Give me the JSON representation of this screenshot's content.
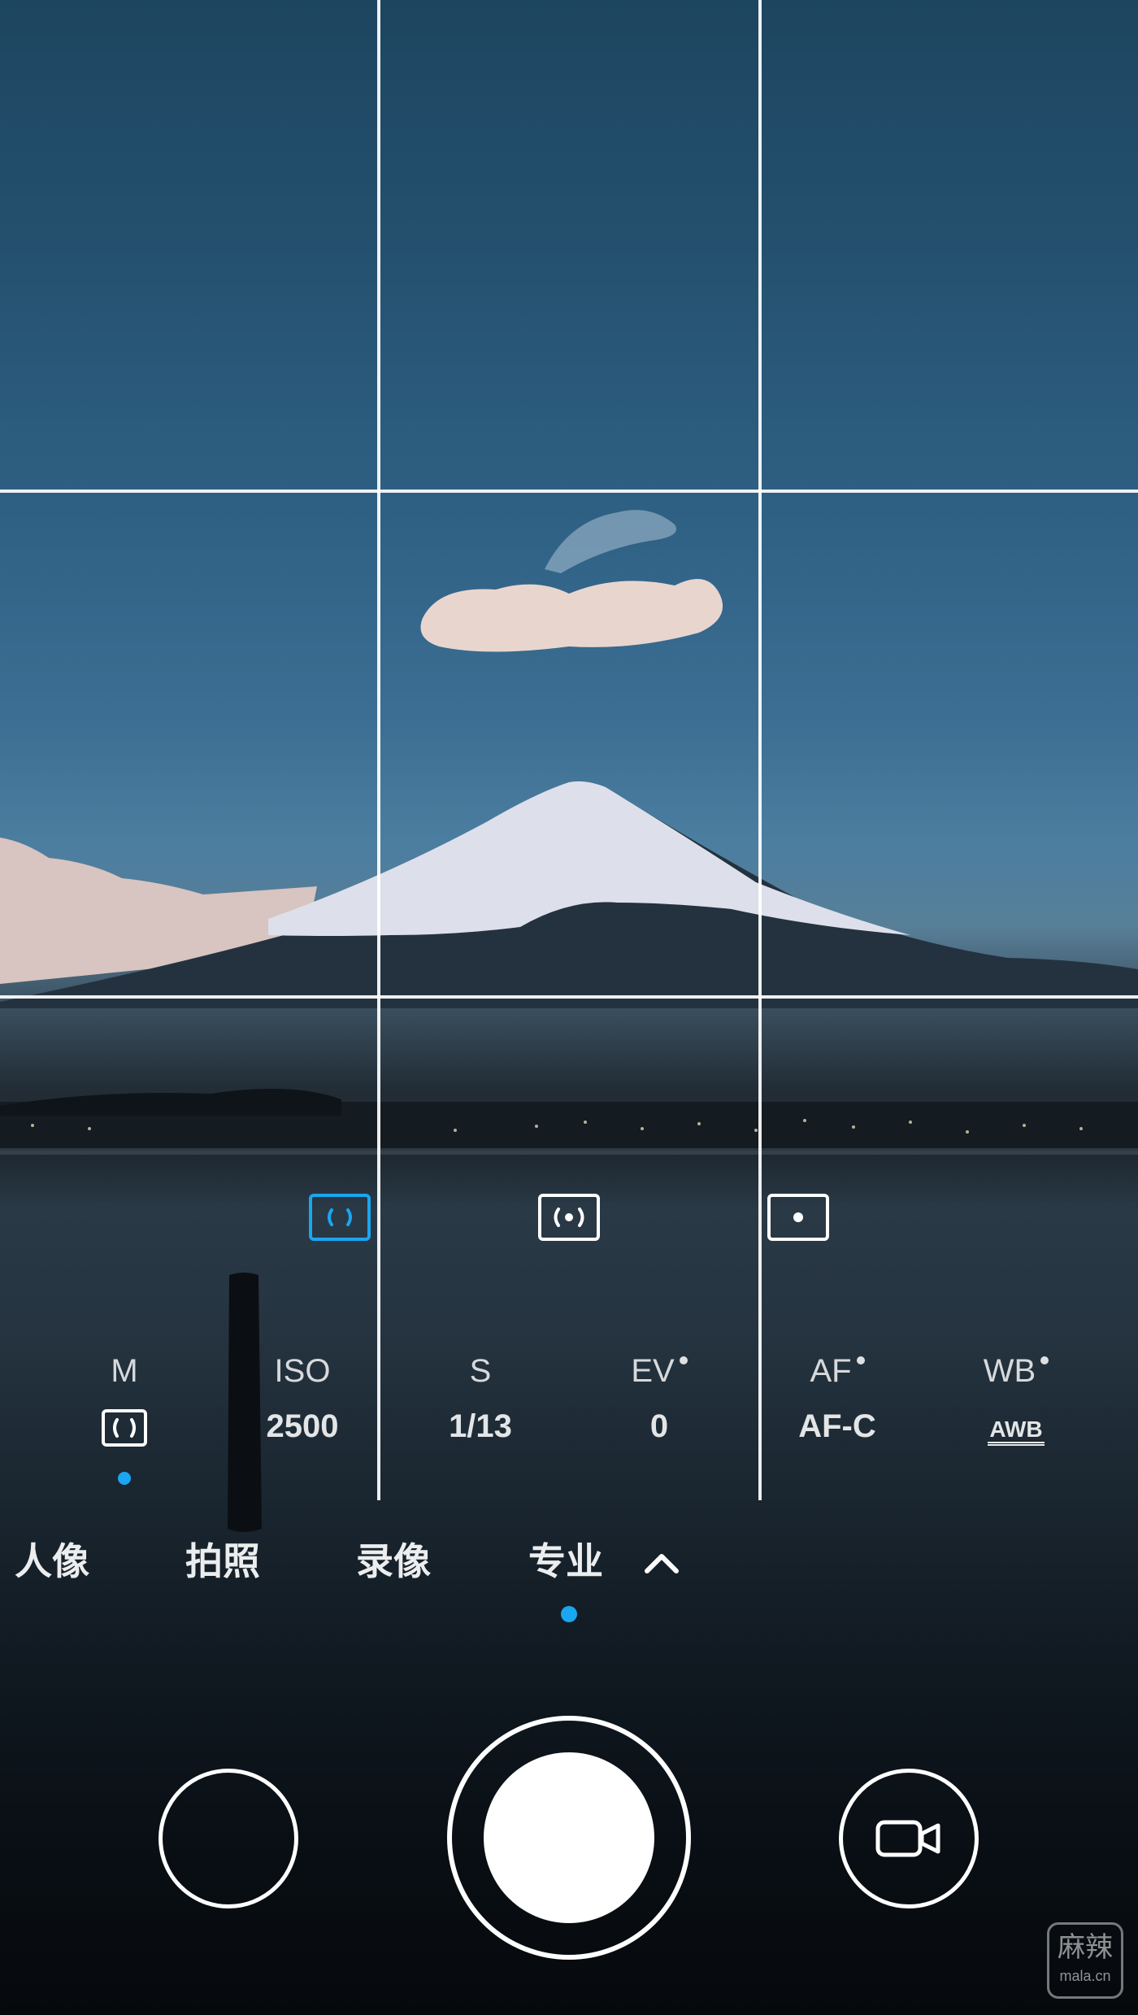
{
  "viewfinder": {
    "metering_modes": [
      {
        "id": "matrix",
        "selected": true
      },
      {
        "id": "center-weighted",
        "selected": false
      },
      {
        "id": "spot",
        "selected": false
      }
    ]
  },
  "pro_params": [
    {
      "label": "M",
      "value": "",
      "value_icon": "metering-matrix-icon",
      "has_dot": false,
      "selected": true
    },
    {
      "label": "ISO",
      "value": "2500",
      "has_dot": false,
      "selected": false
    },
    {
      "label": "S",
      "value": "1/13",
      "has_dot": false,
      "selected": false
    },
    {
      "label": "EV",
      "value": "0",
      "has_dot": true,
      "selected": false
    },
    {
      "label": "AF",
      "value": "AF-C",
      "has_dot": true,
      "selected": false
    },
    {
      "label": "WB",
      "value": "AWB",
      "has_dot": true,
      "selected": false
    }
  ],
  "modes": [
    {
      "label": "人像",
      "active": false
    },
    {
      "label": "拍照",
      "active": false
    },
    {
      "label": "录像",
      "active": false
    },
    {
      "label": "专业",
      "active": true
    }
  ],
  "controls": {
    "expand_icon": "chevron-up-icon",
    "gallery_icon": "gallery-thumbnail",
    "shutter_icon": "shutter-button",
    "video_icon": "video-camera-icon"
  },
  "watermark": {
    "line1": "麻辣",
    "line2": "mala.cn"
  },
  "colors": {
    "accent": "#1aa6f0",
    "foreground": "#ffffff"
  }
}
